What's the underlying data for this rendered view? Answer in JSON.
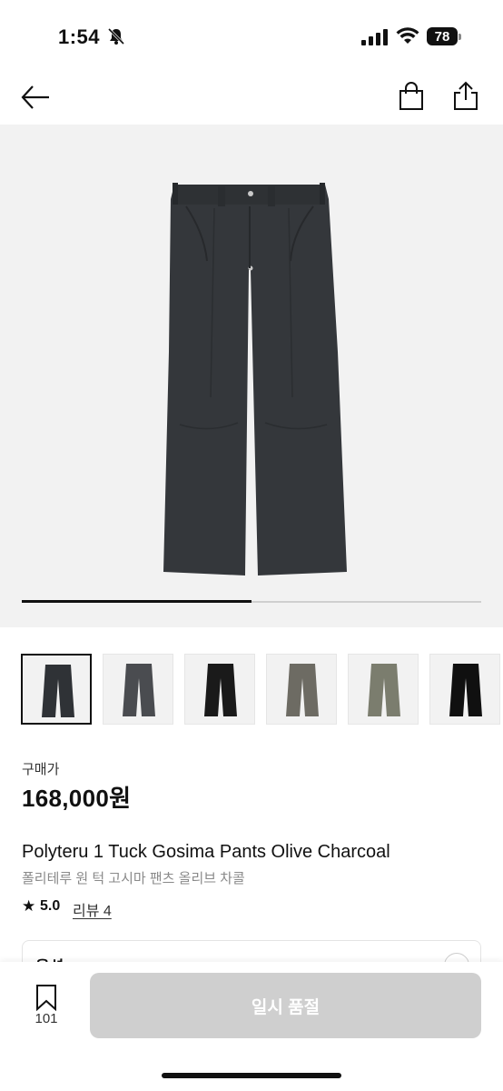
{
  "status_bar": {
    "time": "1:54",
    "battery": "78"
  },
  "product": {
    "price_label": "구매가",
    "price": "168,000원",
    "name_en": "Polyteru 1 Tuck Gosima Pants Olive Charcoal",
    "name_ko": "폴리테루 원 턱 고시마 팬츠 올리브 차콜",
    "rating": "5.0",
    "review_label": "리뷰 4"
  },
  "gallery": {
    "progress": 0.5,
    "thumbnails": [
      {
        "color": "#2f3236",
        "selected": true
      },
      {
        "color": "#4a4c50",
        "selected": false
      },
      {
        "color": "#1a1a1a",
        "selected": false
      },
      {
        "color": "#6d6b63",
        "selected": false
      },
      {
        "color": "#7b7d6e",
        "selected": false
      },
      {
        "color": "#101010",
        "selected": false
      }
    ]
  },
  "option": {
    "label": "옵션"
  },
  "bottom": {
    "bookmark_count": "101",
    "buy_label": "일시 품절"
  }
}
